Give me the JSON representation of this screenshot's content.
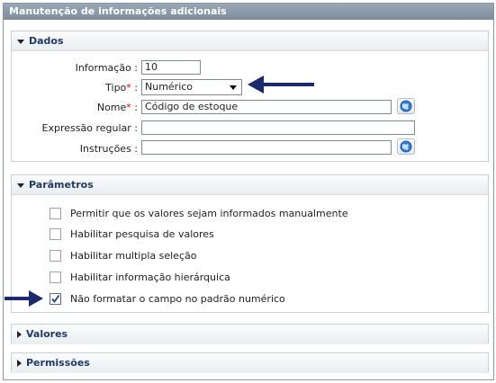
{
  "window": {
    "title": "Manutenção de informações adicionais"
  },
  "dados": {
    "header": "Dados",
    "informacao": {
      "label": "Informação :",
      "value": "10"
    },
    "tipo": {
      "label": "Tipo",
      "required": "*",
      "colon": " :",
      "value": "Numérico"
    },
    "nome": {
      "label": "Nome",
      "required": "*",
      "colon": " :",
      "value": "Código de estoque"
    },
    "expressao": {
      "label": "Expressão regular :",
      "value": ""
    },
    "instrucoes": {
      "label": "Instruções :",
      "value": ""
    }
  },
  "parametros": {
    "header": "Parâmetros",
    "options": [
      {
        "label": "Permitir que os valores sejam informados manualmente",
        "checked": false
      },
      {
        "label": "Habilitar pesquisa de valores",
        "checked": false
      },
      {
        "label": "Habilitar multipla seleção",
        "checked": false
      },
      {
        "label": "Habilitar informação hierárquica",
        "checked": false
      },
      {
        "label": "Não formatar o campo no padrão numérico",
        "checked": true
      }
    ]
  },
  "valores": {
    "header": "Valores"
  },
  "permissoes": {
    "header": "Permissões"
  },
  "colors": {
    "header_text": "#1f3b66",
    "arrow": "#1a2a6c",
    "required": "#dd0000"
  },
  "icons": {
    "translate_button": "globe-icon"
  }
}
